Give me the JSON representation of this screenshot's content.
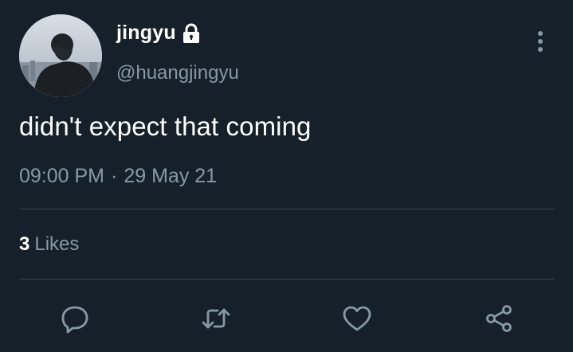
{
  "tweet": {
    "display_name": "jingyu",
    "handle": "@huangjingyu",
    "text": "didn't expect that coming",
    "time": "09:00 PM",
    "separator": "·",
    "date": "29 May 21",
    "likes_count": "3",
    "likes_label": "Likes"
  },
  "icons": {
    "lock": "lock-icon",
    "more": "more-vertical-icon",
    "reply": "reply-icon",
    "retweet": "retweet-icon",
    "like": "heart-icon",
    "share": "share-icon"
  },
  "colors": {
    "background": "#15202b",
    "primary_text": "#ffffff",
    "secondary_text": "#8899a6",
    "divider": "#38444d"
  }
}
